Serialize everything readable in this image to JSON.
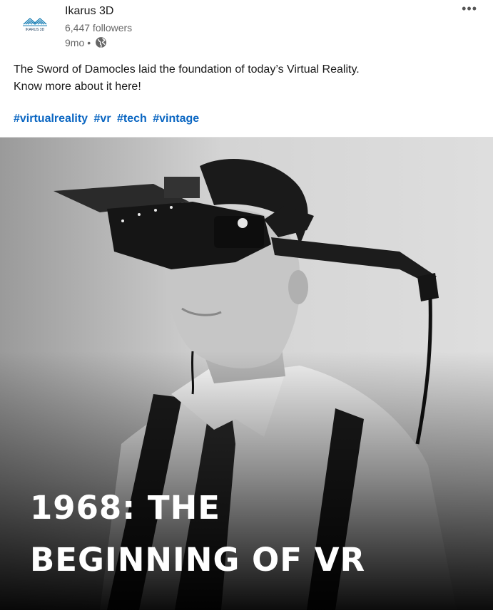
{
  "author": {
    "name": "Ikarus 3D",
    "followers": "6,447 followers",
    "age": "9mo",
    "separator": "•",
    "logo_text": "IKARUS 3D",
    "visibility_icon": "globe-icon"
  },
  "menu": {
    "icon": "more-icon",
    "label": "•••"
  },
  "post": {
    "line1": "The Sword of Damocles laid the foundation of today’s Virtual Reality.",
    "line2": "Know more about it here!",
    "hashtags": [
      "#virtualreality",
      "#vr",
      "#tech",
      "#vintage"
    ]
  },
  "image": {
    "title_line1": "1968: THE",
    "title_line2": "BEGINNING OF VR"
  },
  "colors": {
    "hashtag": "#0a66c2",
    "logo": "#1a7fb5",
    "meta": "#666666"
  }
}
